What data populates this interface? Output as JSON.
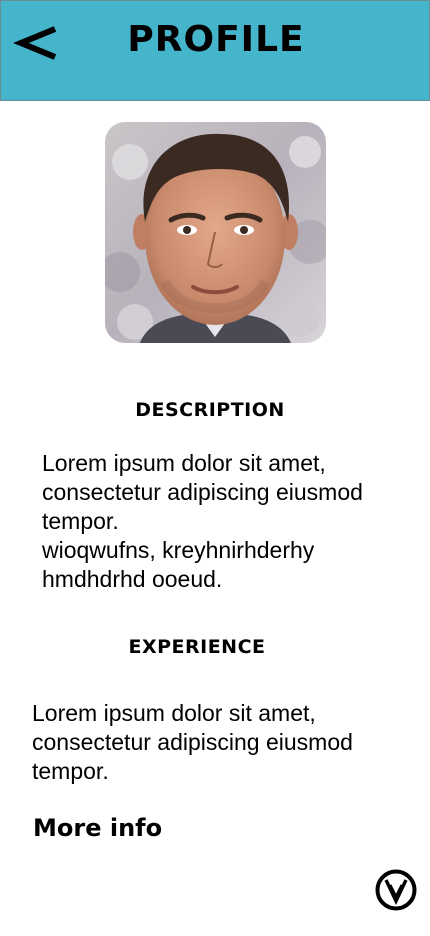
{
  "header": {
    "back_icon": "chevron-left-icon",
    "title": "PROFILE",
    "background": "#45b5cb"
  },
  "profile": {
    "avatar": "portrait-photo"
  },
  "description": {
    "heading": "DESCRIPTION",
    "line1": "Lorem ipsum dolor sit amet, consectetur adipiscing eiusmod tempor.",
    "line2": "wioqwufns, kreyhnirhderhy hmdhdrhd ooeud."
  },
  "experience": {
    "heading": "EXPERIENCE",
    "text": "Lorem ipsum dolor sit amet, consectetur adipiscing eiusmod tempor."
  },
  "more_info": {
    "label": "More info"
  },
  "footer": {
    "logo_icon": "vv-logo-icon"
  }
}
